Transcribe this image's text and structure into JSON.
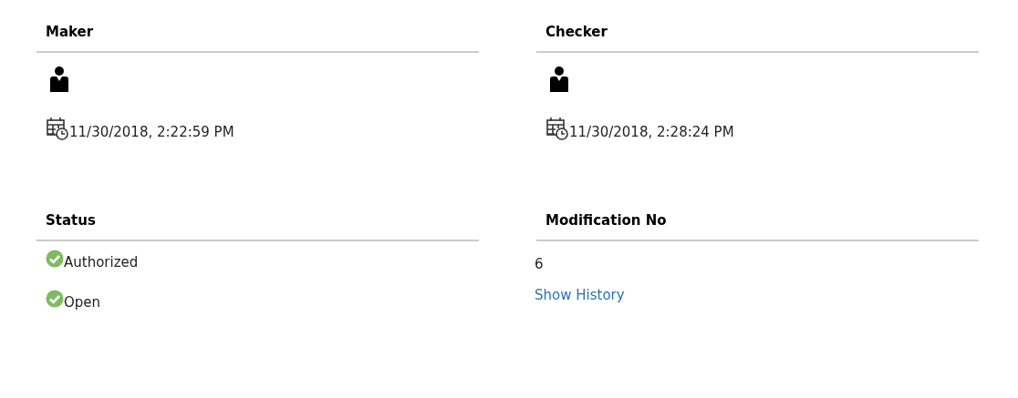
{
  "panels": [
    {
      "kind": "user",
      "title": "Maker",
      "timestamp": "11/30/2018, 2:22:59 PM"
    },
    {
      "kind": "user",
      "title": "Checker",
      "timestamp": "11/30/2018, 2:28:24 PM"
    },
    {
      "kind": "status",
      "title": "Status",
      "items": [
        "Authorized",
        "Open"
      ]
    },
    {
      "kind": "modification",
      "title": "Modification No",
      "value": "6",
      "link": "Show History"
    }
  ]
}
